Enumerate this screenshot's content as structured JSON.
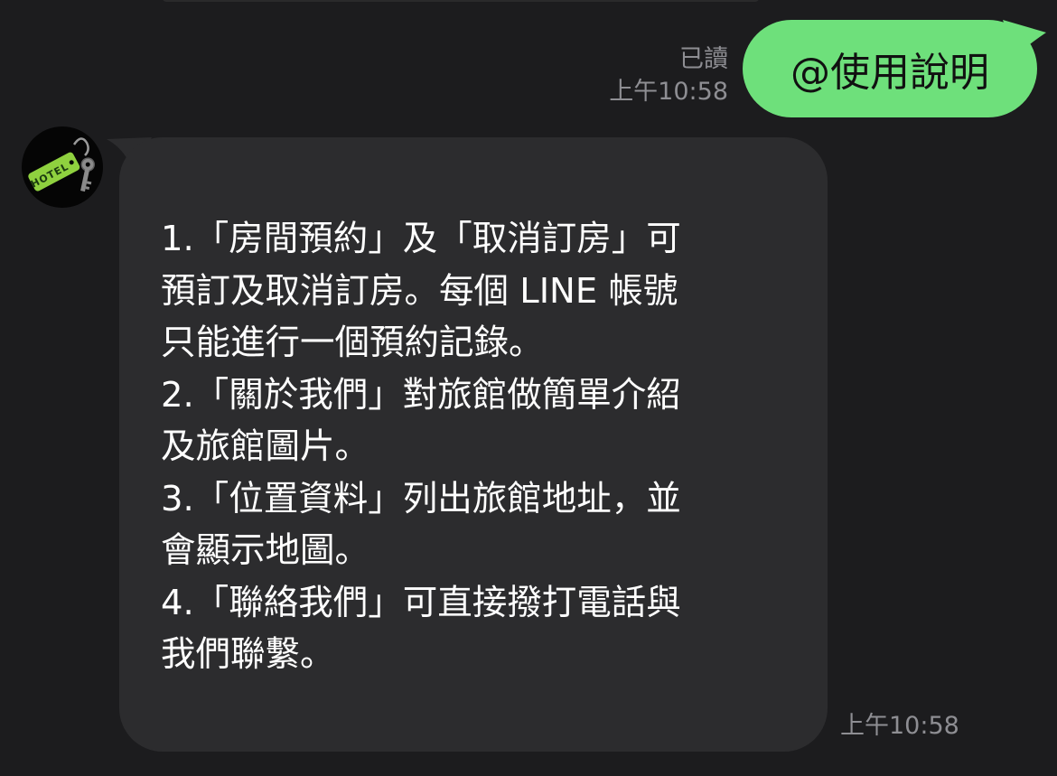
{
  "outgoing": {
    "text": "@使用說明",
    "read_status": "已讀",
    "time": "上午10:58",
    "bubble_color": "#6ee07b"
  },
  "incoming": {
    "avatar": {
      "icon": "hotel-key-icon",
      "tag_text": "HOTEL",
      "tag_color": "#8fd13f"
    },
    "lines": [
      "1.「房間預約」及「取消訂房」可",
      "預訂及取消訂房。每個 LINE 帳號",
      "只能進行一個預約記錄。",
      "2.「關於我們」對旅館做簡單介紹",
      "及旅館圖片。",
      "3.「位置資料」列出旅館地址，並",
      "會顯示地圖。",
      "4.「聯絡我們」可直接撥打電話與",
      "我們聯繫。"
    ],
    "time": "上午10:58",
    "bubble_color": "#2c2c2e"
  }
}
